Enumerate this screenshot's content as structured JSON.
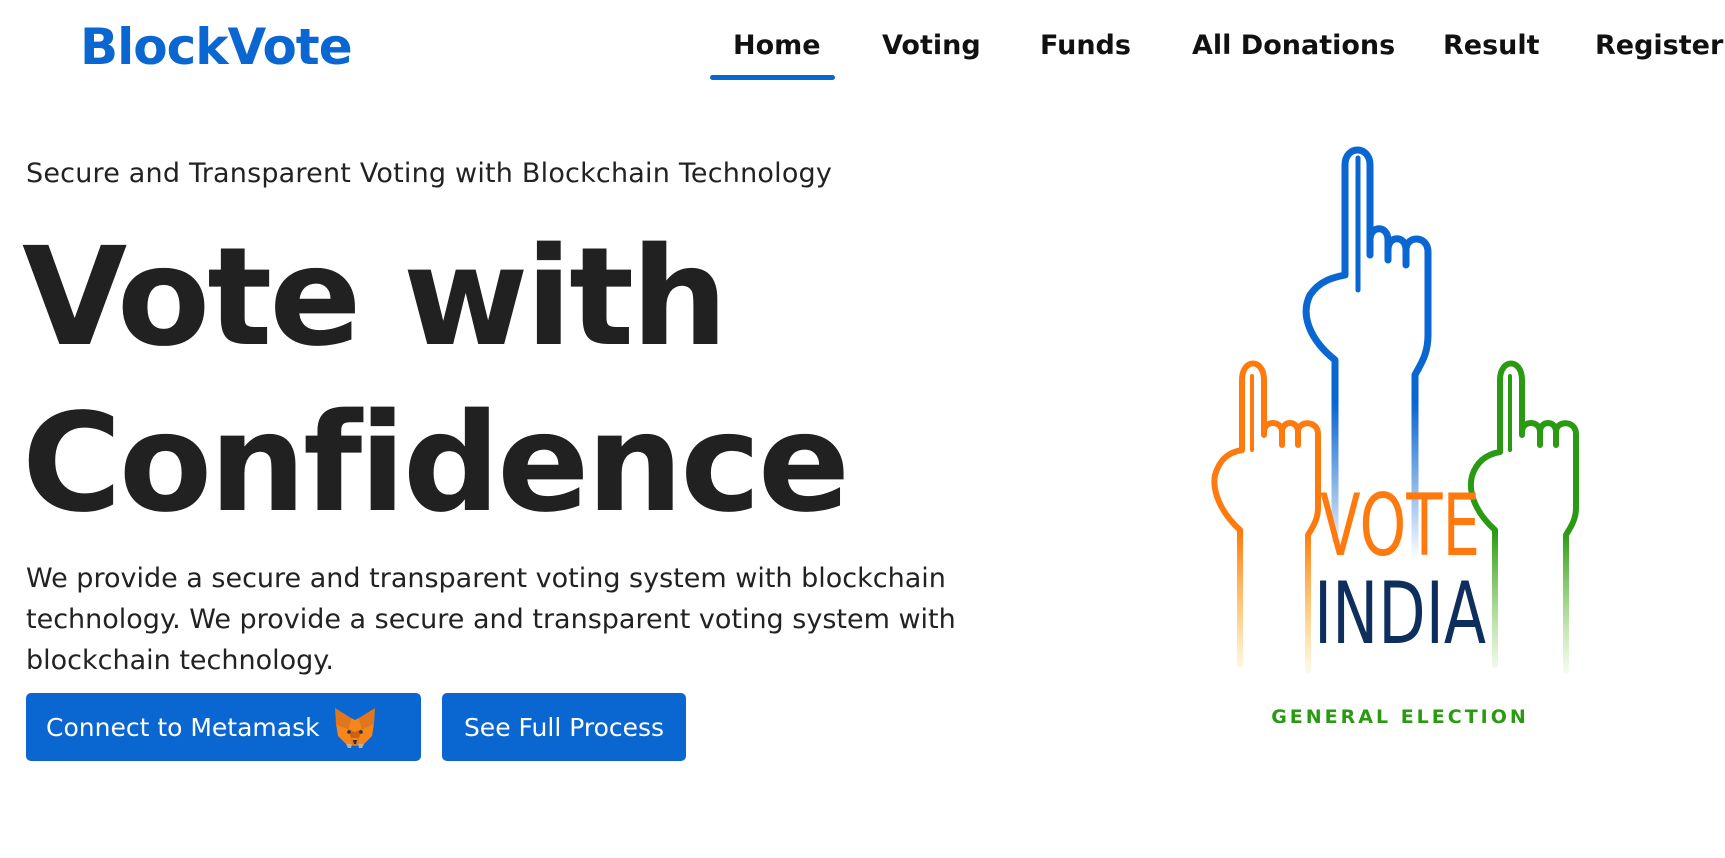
{
  "navbar": {
    "brand": "BlockVote",
    "links": [
      {
        "label": "Home",
        "active": true
      },
      {
        "label": "Voting",
        "active": false
      },
      {
        "label": "Funds",
        "active": false
      },
      {
        "label": "All Donations",
        "active": false
      },
      {
        "label": "Result",
        "active": false
      },
      {
        "label": "Register",
        "active": false
      }
    ]
  },
  "hero": {
    "tagline": "Secure and Transparent Voting with Blockchain Technology",
    "headline_line1": "Vote with",
    "headline_line2": "Confidence",
    "description_line1": "We provide a secure and transparent voting system with blockchain",
    "description_line2": "technology. We provide a secure and transparent voting system with",
    "description_line3": "blockchain technology.",
    "connect_button_label": "Connect to Metamask",
    "connect_button_icon": "metamask-fox-icon",
    "process_button_label": "See Full Process"
  },
  "poster": {
    "vote_text": "VOTE",
    "country_text": "INDIA",
    "caption": "GENERAL ELECTION"
  },
  "colors": {
    "brand": "#0a66d0",
    "saffron": "#ff7a0e",
    "green": "#2a9a12",
    "navy": "#0e2f5e"
  }
}
